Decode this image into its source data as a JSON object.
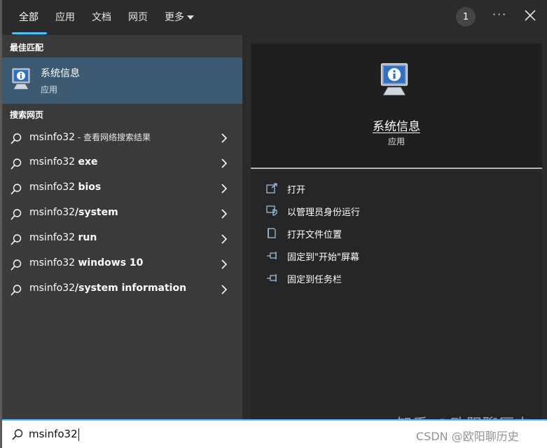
{
  "tabs": {
    "all": "全部",
    "apps": "应用",
    "documents": "文档",
    "web": "网页",
    "more": "更多"
  },
  "header": {
    "badge_count": "1",
    "more_glyph": "···"
  },
  "best_match": {
    "header": "最佳匹配",
    "name": "系统信息",
    "type": "应用"
  },
  "web_search": {
    "header": "搜索网页",
    "items": [
      {
        "query": "msinfo32",
        "bold": "",
        "suffix": " - 查看网络搜索结果"
      },
      {
        "query": "msinfo32 ",
        "bold": "exe",
        "suffix": ""
      },
      {
        "query": "msinfo32 ",
        "bold": "bios",
        "suffix": ""
      },
      {
        "query": "msinfo32",
        "bold": "/system",
        "suffix": ""
      },
      {
        "query": "msinfo32 ",
        "bold": "run",
        "suffix": ""
      },
      {
        "query": "msinfo32 ",
        "bold": "windows 10",
        "suffix": ""
      },
      {
        "query": "msinfo32",
        "bold": "/system information",
        "suffix": ""
      }
    ]
  },
  "detail": {
    "title": "系统信息",
    "subtitle": "应用",
    "actions": [
      {
        "label": "打开",
        "icon": "open-icon"
      },
      {
        "label": "以管理员身份运行",
        "icon": "shield-admin-icon"
      },
      {
        "label": "打开文件位置",
        "icon": "file-location-icon"
      },
      {
        "label": "固定到\"开始\"屏幕",
        "icon": "pin-icon"
      },
      {
        "label": "固定到任务栏",
        "icon": "pin-icon"
      }
    ]
  },
  "search": {
    "value": "msinfo32"
  },
  "watermark": {
    "line1": "知乎 @欧阳聊历史",
    "line2": "CSDN @欧阳聊历史"
  },
  "colors": {
    "accent": "#4cc2ff",
    "selected": "#3d5a73",
    "left_pane": "#3a3a3a",
    "right_pane": "#262626"
  }
}
